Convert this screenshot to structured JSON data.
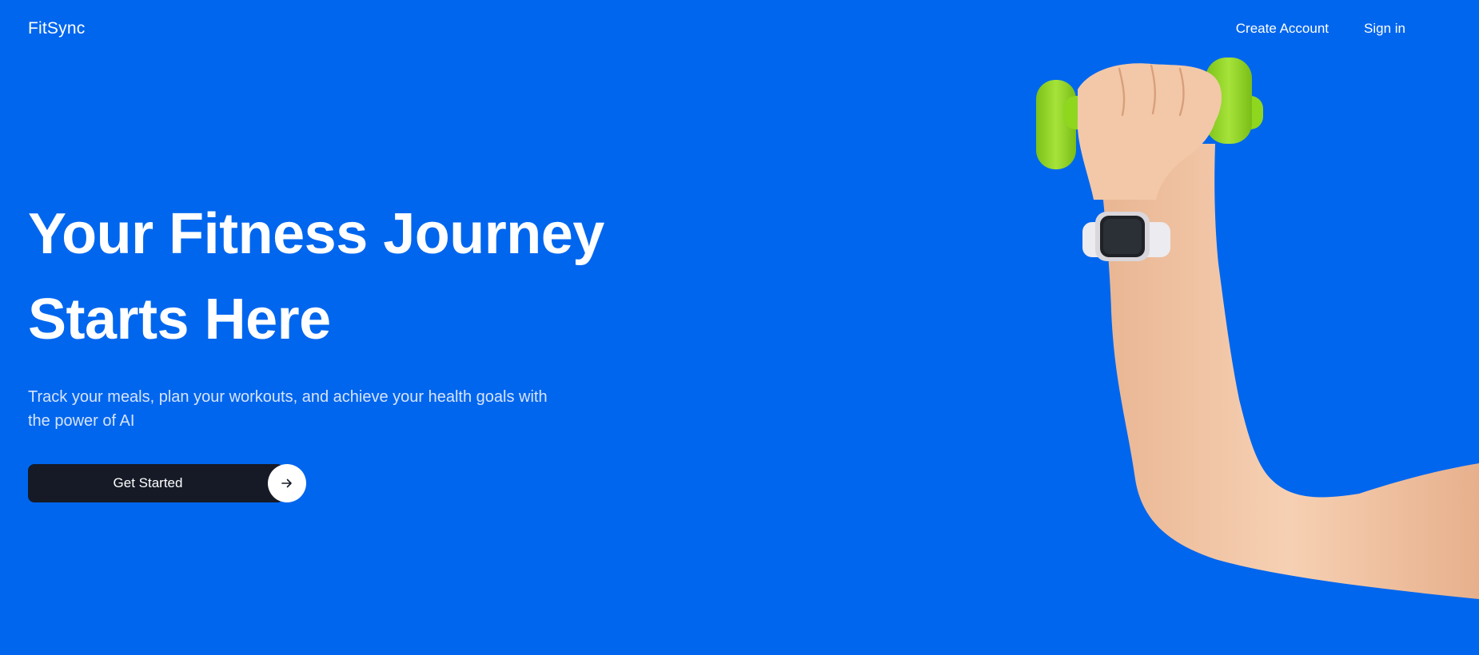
{
  "header": {
    "logo": "FitSync",
    "nav": [
      {
        "label": "Create Account"
      },
      {
        "label": "Sign in"
      }
    ]
  },
  "hero": {
    "headline_line1": "Your Fitness Journey",
    "headline_line2": "Starts Here",
    "subtitle": "Track your meals, plan your workouts, and achieve your health goals with the power of AI",
    "cta_label": "Get Started",
    "cta_icon": "arrow-right-icon"
  },
  "image": {
    "subject": "hand-with-dumbbell-and-smartwatch"
  },
  "colors": {
    "background": "#0066ee",
    "button": "#161a26",
    "dumbbell": "#8fd61f",
    "skin": "#f4c9a8"
  }
}
